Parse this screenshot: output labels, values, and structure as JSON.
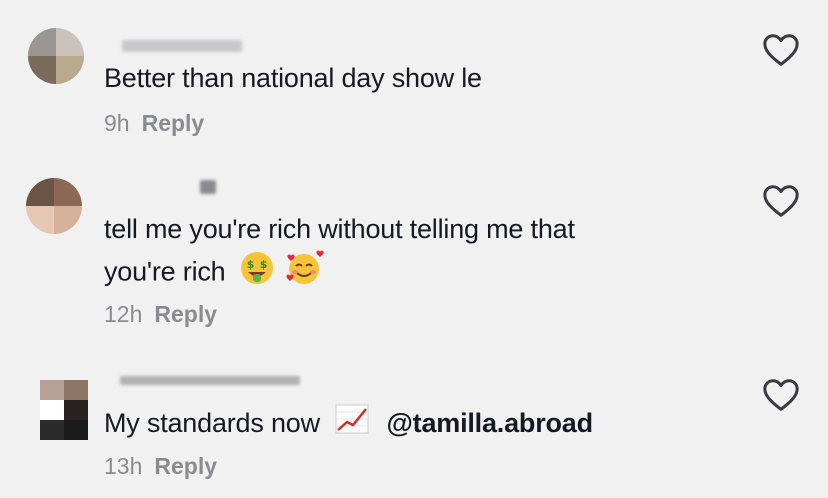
{
  "comments": [
    {
      "text": "Better than national day show le",
      "time": "9h",
      "reply_label": "Reply"
    },
    {
      "text_line1": "tell me you're rich without telling me that",
      "text_line2": "you're rich",
      "emojis": [
        "money-mouth-face",
        "smiling-face-with-hearts"
      ],
      "time": "12h",
      "reply_label": "Reply"
    },
    {
      "text": "My standards now",
      "emoji": "chart-increasing",
      "mention": "@tamilla.abroad",
      "time": "13h",
      "reply_label": "Reply"
    }
  ],
  "icons": {
    "like": "heart-outline-icon"
  },
  "colors": {
    "background": "#f1f1f2",
    "text": "#161823",
    "meta": "#8a8b91",
    "heart_stroke": "#3a3b42"
  }
}
